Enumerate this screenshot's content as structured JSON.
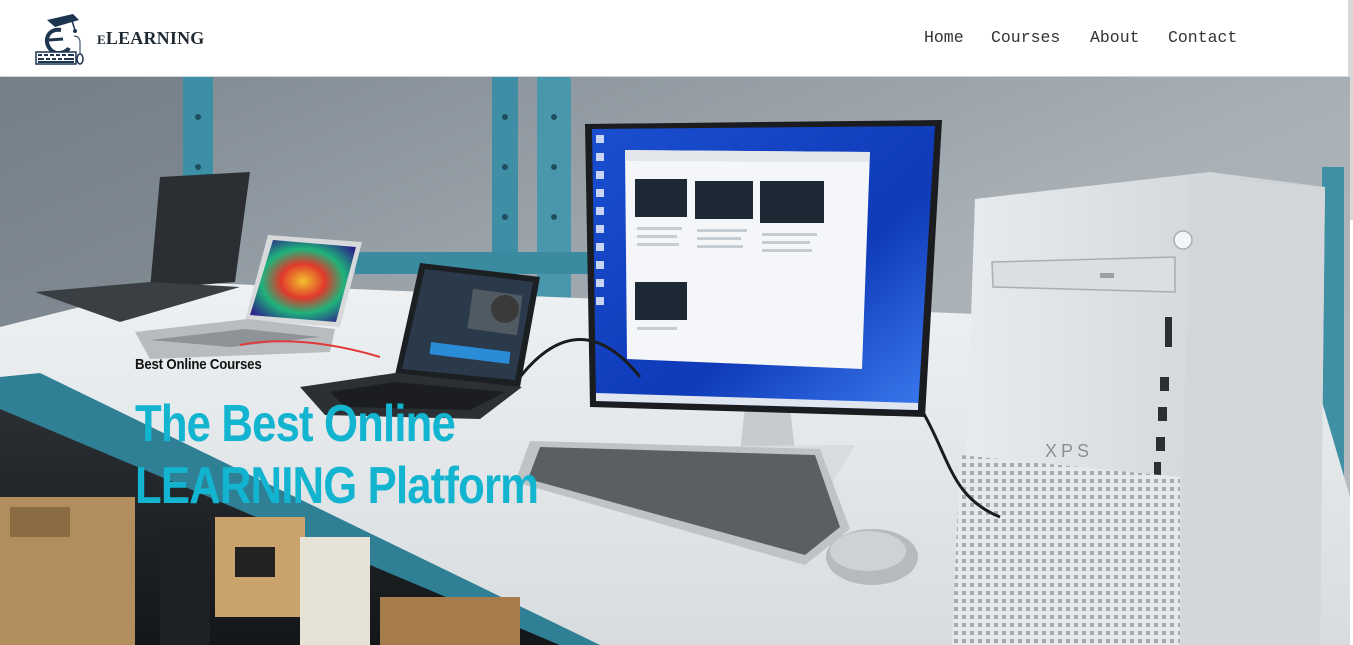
{
  "brand": {
    "first_letter": "E",
    "rest": "LEARNING",
    "logo_icon": "graduation-cap-e-logo"
  },
  "nav": {
    "home": "Home",
    "courses": "Courses",
    "about": "About",
    "contact": "Contact"
  },
  "hero": {
    "subtitle": "Best Online Courses",
    "headline_line1": "The Best Online",
    "headline_line2": "LEARNING Platform",
    "accent_color": "#12b4d0",
    "background_image": "desk-with-laptops-monitor-and-xps-pc",
    "pc_label": "XPS"
  }
}
